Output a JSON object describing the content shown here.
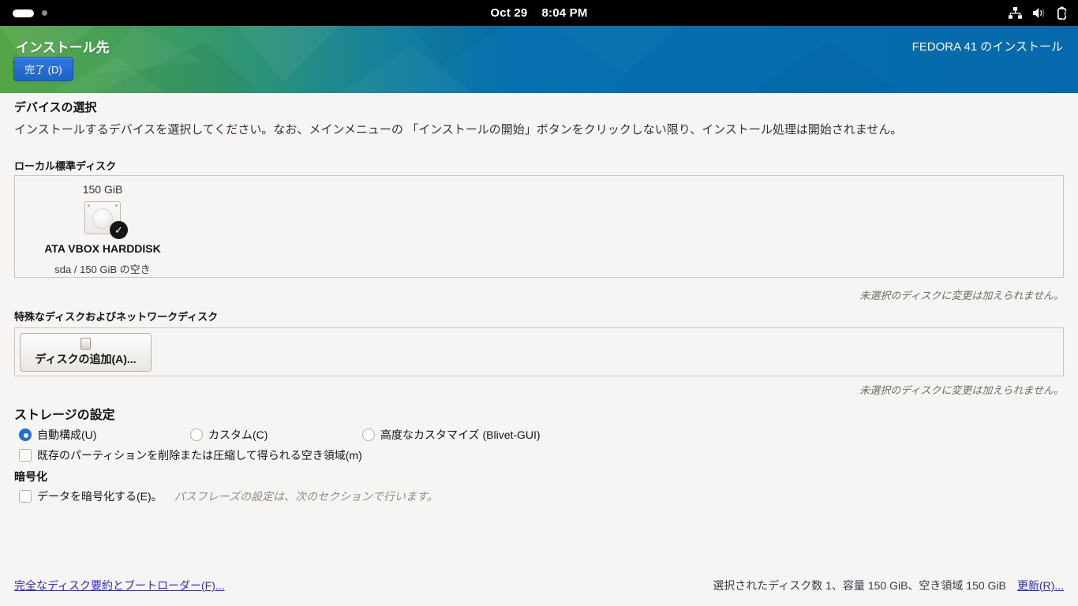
{
  "topbar": {
    "clock_date": "Oct 29",
    "clock_time": "8:04 PM",
    "tray_icons": [
      "network-wired-icon",
      "volume-icon",
      "battery-charging-icon"
    ]
  },
  "header": {
    "title": "インストール先",
    "done_button": "完了 (D)",
    "product": "FEDORA 41 のインストール"
  },
  "device_selection": {
    "heading": "デバイスの選択",
    "description": "インストールするデバイスを選択してください。なお、メインメニューの 「インストールの開始」ボタンをクリックしない限り、インストール処理は開始されません。"
  },
  "local_disks": {
    "heading": "ローカル標準ディスク",
    "disk": {
      "capacity": "150 GiB",
      "name": "ATA VBOX HARDDISK",
      "detail": "sda / 150 GiB の空き",
      "selected": true
    },
    "note": "未選択のディスクに変更は加えられません。"
  },
  "special_disks": {
    "heading": "特殊なディスクおよびネットワークディスク",
    "add_button": "ディスクの追加(A)...",
    "note": "未選択のディスクに変更は加えられません。"
  },
  "storage_config": {
    "heading": "ストレージの設定",
    "options": [
      {
        "label": "自動構成(U)",
        "selected": true
      },
      {
        "label": "カスタム(C)",
        "selected": false
      },
      {
        "label": "高度なカスタマイズ (Blivet-GUI)",
        "selected": false
      }
    ],
    "reclaim_checkbox": "既存のパーティションを削除または圧縮して得られる空き領域(m)",
    "reclaim_checked": false
  },
  "encryption": {
    "heading": "暗号化",
    "checkbox": "データを暗号化する(E)。",
    "checked": false,
    "hint": "パスフレーズの設定は、次のセクションで行います。"
  },
  "footer": {
    "summary_link": "完全なディスク要約とブートローダー(F)...",
    "status": "選択されたディスク数 1、容量 150 GiB、空き領域 150 GiB",
    "refresh_link": "更新(R)..."
  },
  "colors": {
    "topbar_bg": "#000000",
    "banner_green": "#55a546",
    "banner_blue": "#0669ad",
    "done_button_blue": "#2268d1",
    "radio_blue": "#1c71d8",
    "link_blue": "#2b2be0",
    "content_bg": "#f6f5f4"
  }
}
